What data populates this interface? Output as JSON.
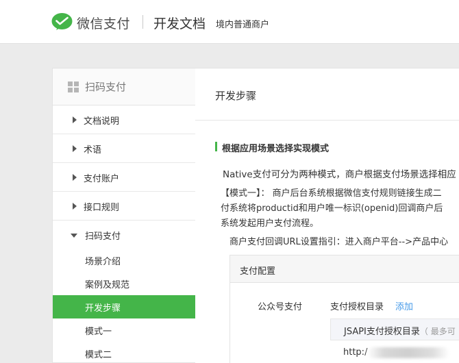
{
  "header": {
    "brand": "微信支付",
    "title": "开发文档",
    "subtitle": "境内普通商户",
    "brand_color": "#44b549"
  },
  "sidebar": {
    "section_title": "扫码支付",
    "items": [
      {
        "label": "文档说明",
        "expanded": false
      },
      {
        "label": "术语",
        "expanded": false
      },
      {
        "label": "支付账户",
        "expanded": false
      },
      {
        "label": "接口规则",
        "expanded": false
      },
      {
        "label": "扫码支付",
        "expanded": true
      }
    ],
    "subitems": [
      {
        "label": "场景介绍",
        "active": false
      },
      {
        "label": "案例及规范",
        "active": false
      },
      {
        "label": "开发步骤",
        "active": true
      },
      {
        "label": "模式一",
        "active": false
      },
      {
        "label": "模式二",
        "active": false
      }
    ]
  },
  "content": {
    "page_title": "开发步骤",
    "section_title": "根据应用场景选择实现模式",
    "para1": "Native支付可分为两种模式，商户根据支付场景选择相应",
    "para2_line1": "【模式一】： 商户后台系统根据微信支付规则链接生成二",
    "para2_line2": "付系统将productid和用户唯一标识(openid)回调商户后",
    "para2_line3": "系统发起用户支付流程。",
    "para3": "商户支付回调URL设置指引：进入商户平台-->产品中心",
    "config": {
      "header": "支付配置",
      "row_label": "公众号支付",
      "dir_label": "支付授权目录",
      "add_link": "添加",
      "inner_label": "JSAPI支付授权目录",
      "inner_hint": "（ 最多可",
      "url_prefix": "http:/"
    }
  }
}
